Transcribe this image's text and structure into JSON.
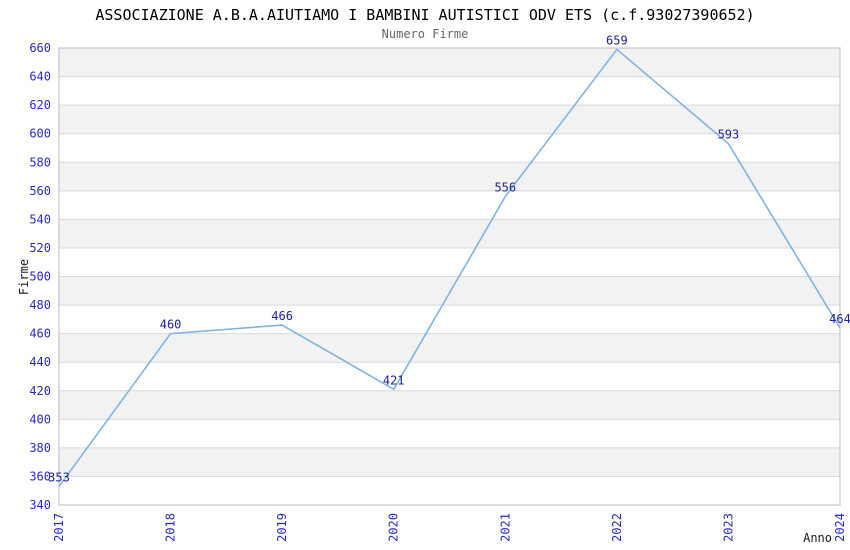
{
  "chart_data": {
    "type": "line",
    "title": "ASSOCIAZIONE A.B.A.AIUTIAMO I BAMBINI AUTISTICI ODV ETS (c.f.93027390652)",
    "subtitle": "Numero Firme",
    "xlabel": "Anno",
    "ylabel": "Firme",
    "categories": [
      "2017",
      "2018",
      "2019",
      "2020",
      "2021",
      "2022",
      "2023",
      "2024"
    ],
    "values": [
      353,
      460,
      466,
      421,
      556,
      659,
      593,
      464
    ],
    "ylim": [
      340,
      660
    ],
    "ytick_step": 20,
    "grid": "horizontal-alternating-bands",
    "legend": "none",
    "series_name": "Numero Firme",
    "colors": {
      "line": "#7fb2e5",
      "data_label": "#21219b",
      "tick_label": "#2a2acc",
      "band": "#f2f2f2",
      "band_alt": "#ffffff",
      "gridline": "#d9d9d9",
      "border": "#c6c6c6",
      "title": "#000000",
      "subtitle": "#666666",
      "axis_title": "#1a1a1a",
      "background": "#ffffff"
    }
  }
}
